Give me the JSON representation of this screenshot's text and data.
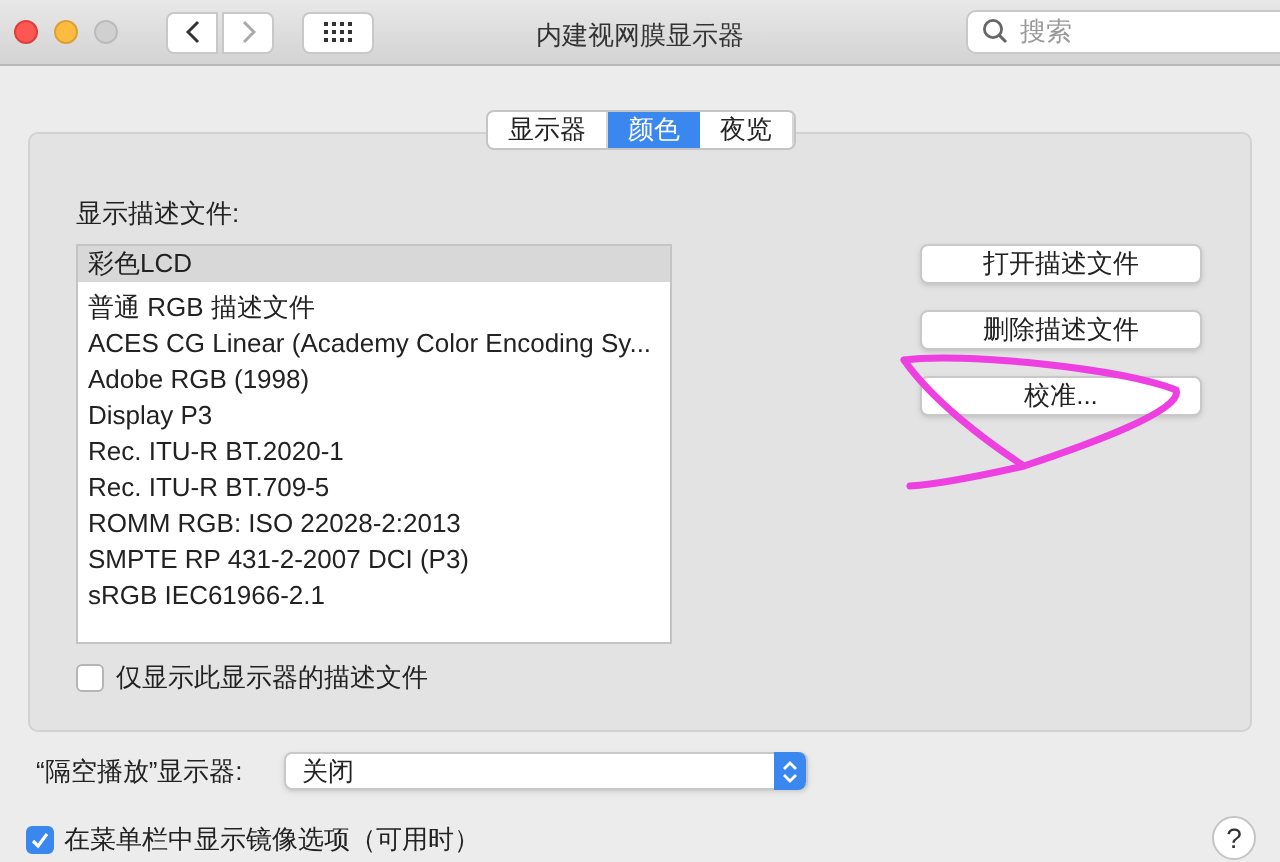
{
  "window": {
    "title": "内建视网膜显示器"
  },
  "search": {
    "placeholder": "搜索"
  },
  "tabs": [
    {
      "label": "显示器",
      "selected": false
    },
    {
      "label": "颜色",
      "selected": true
    },
    {
      "label": "夜览",
      "selected": false
    }
  ],
  "profiles": {
    "label": "显示描述文件:",
    "items": [
      {
        "label": "彩色LCD",
        "selected": true
      },
      {
        "label": "普通 RGB 描述文件",
        "selected": false
      },
      {
        "label": "ACES CG Linear (Academy Color Encoding Sy...",
        "selected": false
      },
      {
        "label": "Adobe RGB (1998)",
        "selected": false
      },
      {
        "label": "Display P3",
        "selected": false
      },
      {
        "label": "Rec. ITU-R BT.2020-1",
        "selected": false
      },
      {
        "label": "Rec. ITU-R BT.709-5",
        "selected": false
      },
      {
        "label": "ROMM RGB: ISO 22028-2:2013",
        "selected": false
      },
      {
        "label": "SMPTE RP 431-2-2007 DCI (P3)",
        "selected": false
      },
      {
        "label": "sRGB IEC61966-2.1",
        "selected": false
      }
    ]
  },
  "only_this_display": {
    "label": "仅显示此显示器的描述文件",
    "checked": false
  },
  "buttons": [
    "打开描述文件",
    "删除描述文件",
    "校准..."
  ],
  "airplay": {
    "label": "“隔空播放”显示器:",
    "value": "关闭"
  },
  "mirror_option": {
    "label": "在菜单栏中显示镜像选项（可用时）",
    "checked": true
  },
  "help": "?"
}
